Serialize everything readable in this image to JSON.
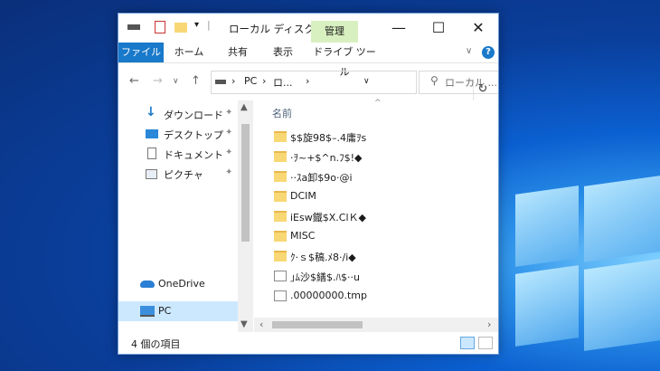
{
  "titlebar": {
    "title": "ローカル ディスク (E:)",
    "contextual_tab": "管理",
    "minimize_glyph": "—",
    "maximize_glyph": "☐",
    "close_glyph": "✕"
  },
  "ribbon": {
    "tabs": [
      "ファイル",
      "ホーム",
      "共有",
      "表示",
      "ドライブ ツール"
    ],
    "help_glyph": "?"
  },
  "address": {
    "path_parts": [
      "PC",
      "ロ..."
    ],
    "sep": "›",
    "search_placeholder": "ローカル ..."
  },
  "sidebar": {
    "items": [
      {
        "label": "ダウンロード",
        "icon": "download-icon",
        "pinned": true
      },
      {
        "label": "デスクトップ",
        "icon": "desktop-icon",
        "pinned": true
      },
      {
        "label": "ドキュメント",
        "icon": "documents-icon",
        "pinned": true
      },
      {
        "label": "ピクチャ",
        "icon": "pictures-icon",
        "pinned": true
      },
      {
        "label": "OneDrive",
        "icon": "onedrive-icon",
        "pinned": false
      },
      {
        "label": "PC",
        "icon": "pc-icon",
        "pinned": false
      }
    ],
    "pin_glyph": "📌"
  },
  "main": {
    "column_header": "名前",
    "files": [
      {
        "name": "$$旋98$–.4庸ｦs",
        "type": "folder"
      },
      {
        "name": "·ｦ~+$^n.ﾌ$!◆",
        "type": "folder"
      },
      {
        "name": "··ｽa卸$9o·@i",
        "type": "folder"
      },
      {
        "name": "DCIM",
        "type": "folder"
      },
      {
        "name": "iEsw鐡$X.ClＫ◆",
        "type": "folder"
      },
      {
        "name": "MISC",
        "type": "folder"
      },
      {
        "name": "ｸ·ｓ$稿.ﾒ8·/i◆",
        "type": "folder"
      },
      {
        "name": "｣ﾑ沙$繕$.ﾊ$··u",
        "type": "file"
      },
      {
        "name": ".00000000.tmp",
        "type": "file"
      }
    ]
  },
  "status": {
    "item_count": "4 個の項目"
  }
}
